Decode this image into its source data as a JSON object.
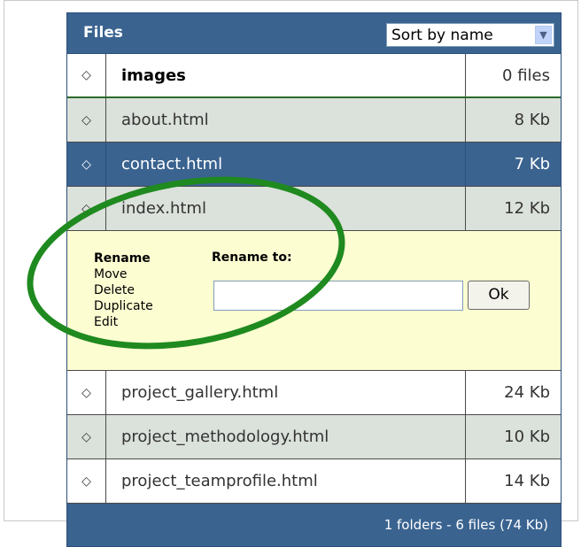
{
  "header": {
    "title": "Files",
    "sort_label": "Sort by name"
  },
  "rows_top": [
    {
      "name": "images",
      "size": "0 files",
      "style": "folder white"
    },
    {
      "name": "about.html",
      "size": "8 Kb",
      "style": "gray"
    },
    {
      "name": "contact.html",
      "size": "7 Kb",
      "style": "selected"
    },
    {
      "name": "index.html",
      "size": "12 Kb",
      "style": "gray"
    }
  ],
  "editor": {
    "operations": [
      "Rename",
      "Move",
      "Delete",
      "Duplicate",
      "Edit"
    ],
    "active_operation": "Rename",
    "rename_to_label": "Rename to:",
    "input_value": "",
    "ok_label": "Ok"
  },
  "rows_bottom": [
    {
      "name": "project_gallery.html",
      "size": "24 Kb",
      "style": "white"
    },
    {
      "name": "project_methodology.html",
      "size": "10 Kb",
      "style": "gray"
    },
    {
      "name": "project_teamprofile.html",
      "size": "14 Kb",
      "style": "white"
    }
  ],
  "footer": {
    "summary": "1 folders - 6 files (74 Kb)"
  },
  "colors": {
    "header_blue": "#3a6390",
    "row_gray": "#dbe1db",
    "editor_yellow": "#fdfdd2",
    "annotation_green": "#1f8a1f"
  },
  "icons": {
    "row_bullet": "diamond-outline-icon",
    "select_arrow": "chevron-down-icon"
  }
}
